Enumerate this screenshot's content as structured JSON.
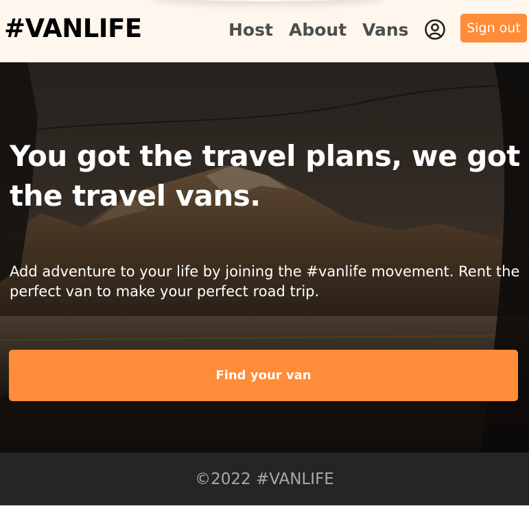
{
  "header": {
    "logo": "#VANLIFE",
    "nav": {
      "host": "Host",
      "about": "About",
      "vans": "Vans"
    },
    "account_icon": "user-circle-icon",
    "signout_label": "Sign out"
  },
  "hero": {
    "title": "You got the travel plans, we got the travel vans.",
    "subtitle": "Add adventure to your life by joining the #vanlife movement. Rent the perfect van to make your perfect road trip.",
    "cta_label": "Find your van",
    "background": "mountain-lake-through-van-window-photo"
  },
  "footer": {
    "copyright": "©2022 #VANLIFE"
  },
  "colors": {
    "accent": "#FF8C38",
    "header_bg": "#FFF7ED",
    "footer_bg": "#252525",
    "nav_text": "#4D4D4D"
  }
}
